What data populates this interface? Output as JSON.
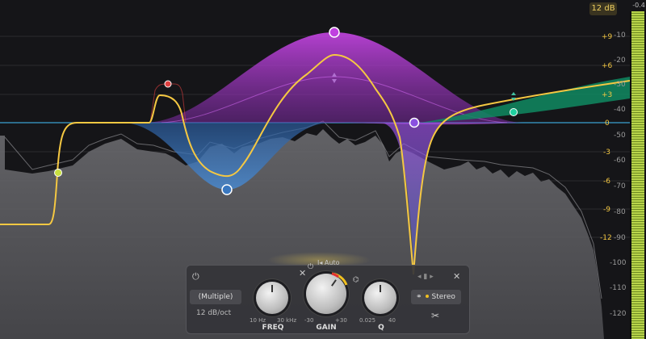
{
  "header": {
    "range_badge": "12 dB",
    "meter_top": "-0.4"
  },
  "gain_scale": [
    "+9",
    "+6",
    "+3",
    "0",
    "-3",
    "-6",
    "-9",
    "-12"
  ],
  "spectrum_scale": [
    "-10",
    "-20",
    "-30",
    "-40",
    "-50",
    "-60",
    "-70",
    "-80",
    "-90",
    "-100",
    "-110",
    "-120"
  ],
  "panel": {
    "power_icon": "⏻",
    "close_left": "✕",
    "close_right": "✕",
    "shape_value": "(Multiple)",
    "slope_value": "12 dB/oct",
    "auto_label": "Auto",
    "freq": {
      "label": "FREQ",
      "min": "10 Hz",
      "max": "30 kHz"
    },
    "gain": {
      "label": "GAIN",
      "min": "-30",
      "max": "+30"
    },
    "q": {
      "label": "Q",
      "min": "0.025",
      "max": "40"
    },
    "stereo_label": "Stereo"
  },
  "colors": {
    "magenta": "#c040e0",
    "blue": "#3a78c0",
    "teal": "#10a070",
    "yellow": "#f5c842",
    "red_band": "#e04040",
    "accent": "#f0c020"
  }
}
